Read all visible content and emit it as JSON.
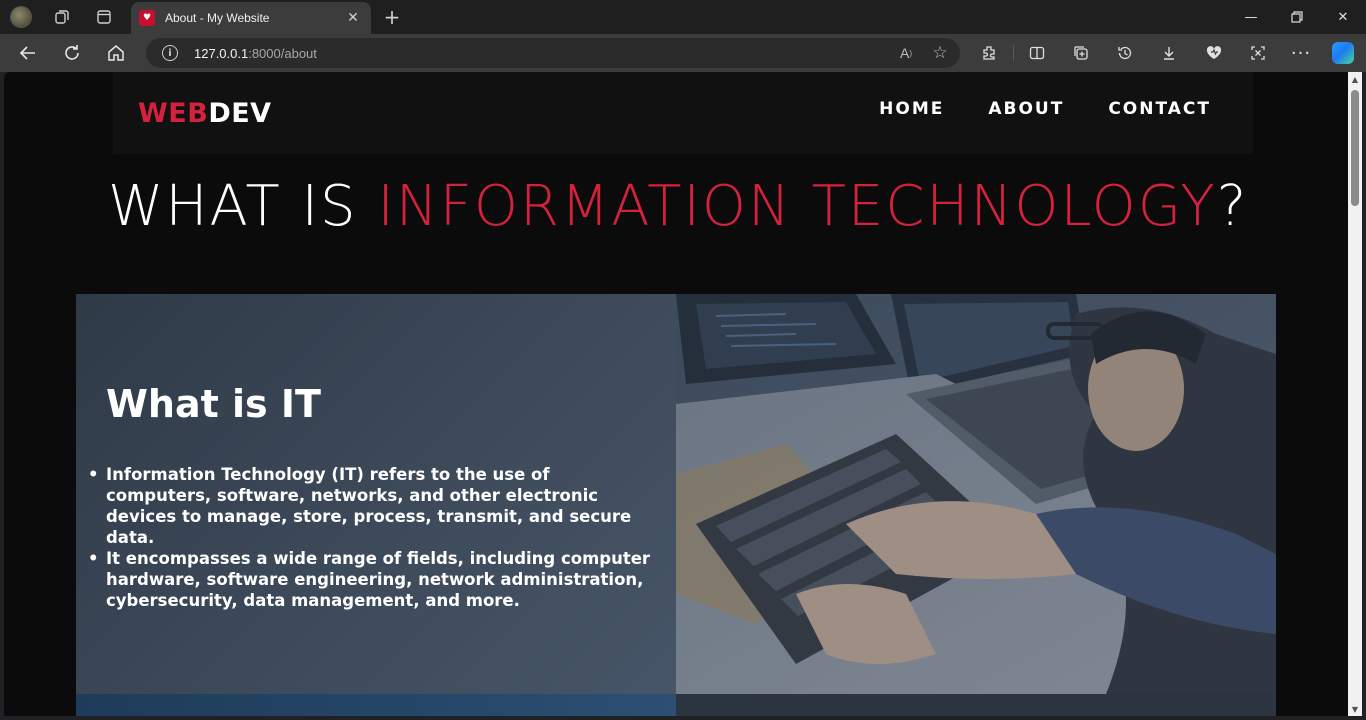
{
  "browser": {
    "tab_title": "About - My Website",
    "url_host": "127.0.0.1",
    "url_rest": ":8000/about",
    "icons": [
      "profile-icon",
      "workspaces-icon",
      "tab-actions-icon",
      "close-icon",
      "new-tab-icon",
      "back-icon",
      "reload-icon",
      "home-icon",
      "info-icon",
      "read-aloud-icon",
      "favorite-icon",
      "extensions-icon",
      "split-screen-icon",
      "collections-icon",
      "history-icon",
      "downloads-icon",
      "browser-essentials-icon",
      "screenshot-icon",
      "more-icon",
      "copilot-icon",
      "minimize-icon",
      "restore-icon",
      "window-close-icon"
    ]
  },
  "site": {
    "logo_a": "WEB",
    "logo_b": "DEV",
    "nav": [
      "HOME",
      "ABOUT",
      "CONTACT"
    ],
    "hero_pre": "WHAT IS ",
    "hero_highlight": "INFORMATION TECHNOLOGY",
    "hero_post": "?",
    "section_title": "What is IT",
    "bullets": [
      "Information Technology (IT) refers to the use of computers, software, networks, and other electronic devices to manage, store, process, transmit, and secure data.",
      "It encompasses a wide range of fields, including computer hardware, software engineering, network administration, cybersecurity, data management, and more."
    ],
    "accent_color": "#d4213d"
  }
}
